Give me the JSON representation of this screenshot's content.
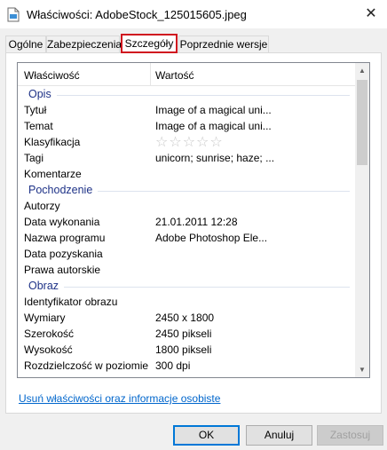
{
  "window": {
    "title": "Właściwości: AdobeStock_125015605.jpeg",
    "close_glyph": "✕",
    "icon": "file-icon"
  },
  "tabs": [
    {
      "label": "Ogólne",
      "active": false
    },
    {
      "label": "Zabezpieczenia",
      "active": false
    },
    {
      "label": "Szczegóły",
      "active": true
    },
    {
      "label": "Poprzednie wersje",
      "active": false
    }
  ],
  "list": {
    "header": {
      "property": "Właściwość",
      "value": "Wartość"
    },
    "groups": [
      {
        "name": "Opis",
        "rows": [
          {
            "property": "Tytuł",
            "value": "Image of a magical uni..."
          },
          {
            "property": "Temat",
            "value": "Image of a magical uni..."
          },
          {
            "property": "Klasyfikacja",
            "value": "☆☆☆☆☆"
          },
          {
            "property": "Tagi",
            "value": "unicorn; sunrise; haze; ..."
          },
          {
            "property": "Komentarze",
            "value": ""
          }
        ]
      },
      {
        "name": "Pochodzenie",
        "rows": [
          {
            "property": "Autorzy",
            "value": ""
          },
          {
            "property": "Data wykonania",
            "value": "21.01.2011 12:28"
          },
          {
            "property": "Nazwa programu",
            "value": "Adobe Photoshop Ele..."
          },
          {
            "property": "Data pozyskania",
            "value": ""
          },
          {
            "property": "Prawa autorskie",
            "value": ""
          }
        ]
      },
      {
        "name": "Obraz",
        "rows": [
          {
            "property": "Identyfikator obrazu",
            "value": ""
          },
          {
            "property": "Wymiary",
            "value": "2450 x 1800"
          },
          {
            "property": "Szerokość",
            "value": "2450 pikseli"
          },
          {
            "property": "Wysokość",
            "value": "1800 pikseli"
          },
          {
            "property": "Rozdzielczość w poziomie",
            "value": "300 dpi"
          }
        ]
      }
    ],
    "rating_stars": 0
  },
  "link_text": "Usuń właściwości oraz informacje osobiste",
  "buttons": {
    "ok": "OK",
    "cancel": "Anuluj",
    "apply": "Zastosuj"
  },
  "colors": {
    "active_tab_highlight": "#d0141f",
    "group_header": "#1e3287",
    "link": "#0066cc"
  }
}
